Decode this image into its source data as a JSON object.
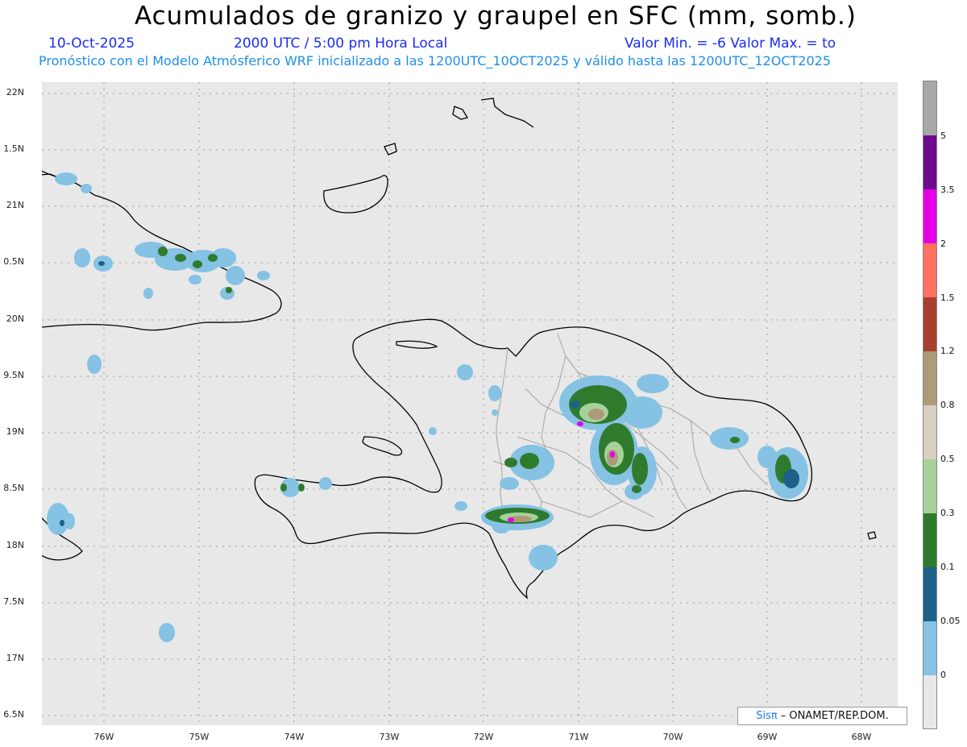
{
  "header": {
    "title": "Acumulados de granizo y graupel en SFC (mm, somb.)",
    "date": "10-Oct-2025",
    "time": "2000 UTC / 5:00 pm Hora Local",
    "minmax": "Valor Min. = -6  Valor Max. = to",
    "forecast": "Pronóstico con el Modelo Atmósferico WRF inicializado a las 1200UTC_10OCT2025 y válido hasta las  1200UTC_12OCT2025"
  },
  "axes": {
    "lat_labels": [
      "22N",
      "1.5N",
      "21N",
      "0.5N",
      "20N",
      "9.5N",
      "19N",
      "8.5N",
      "18N",
      "7.5N",
      "17N",
      "6.5N"
    ],
    "lon_labels": [
      "76W",
      "75W",
      "74W",
      "73W",
      "72W",
      "71W",
      "70W",
      "69W",
      "68W"
    ]
  },
  "colorbar": {
    "labels": [
      "5",
      "3.5",
      "2",
      "1.5",
      "1.2",
      "0.8",
      "0.5",
      "0.3",
      "0.1",
      "0.05",
      "0"
    ],
    "colors": [
      "#a8a8a8",
      "#6e0a8c",
      "#e600e6",
      "#ff7060",
      "#a84030",
      "#ad9a78",
      "#d8cfc0",
      "#a6d29a",
      "#2e7b2e",
      "#1c6288",
      "#85c2e4"
    ]
  },
  "credit": {
    "sis": "Sisπ",
    "text": "– ONAMET/REP.DOM."
  }
}
